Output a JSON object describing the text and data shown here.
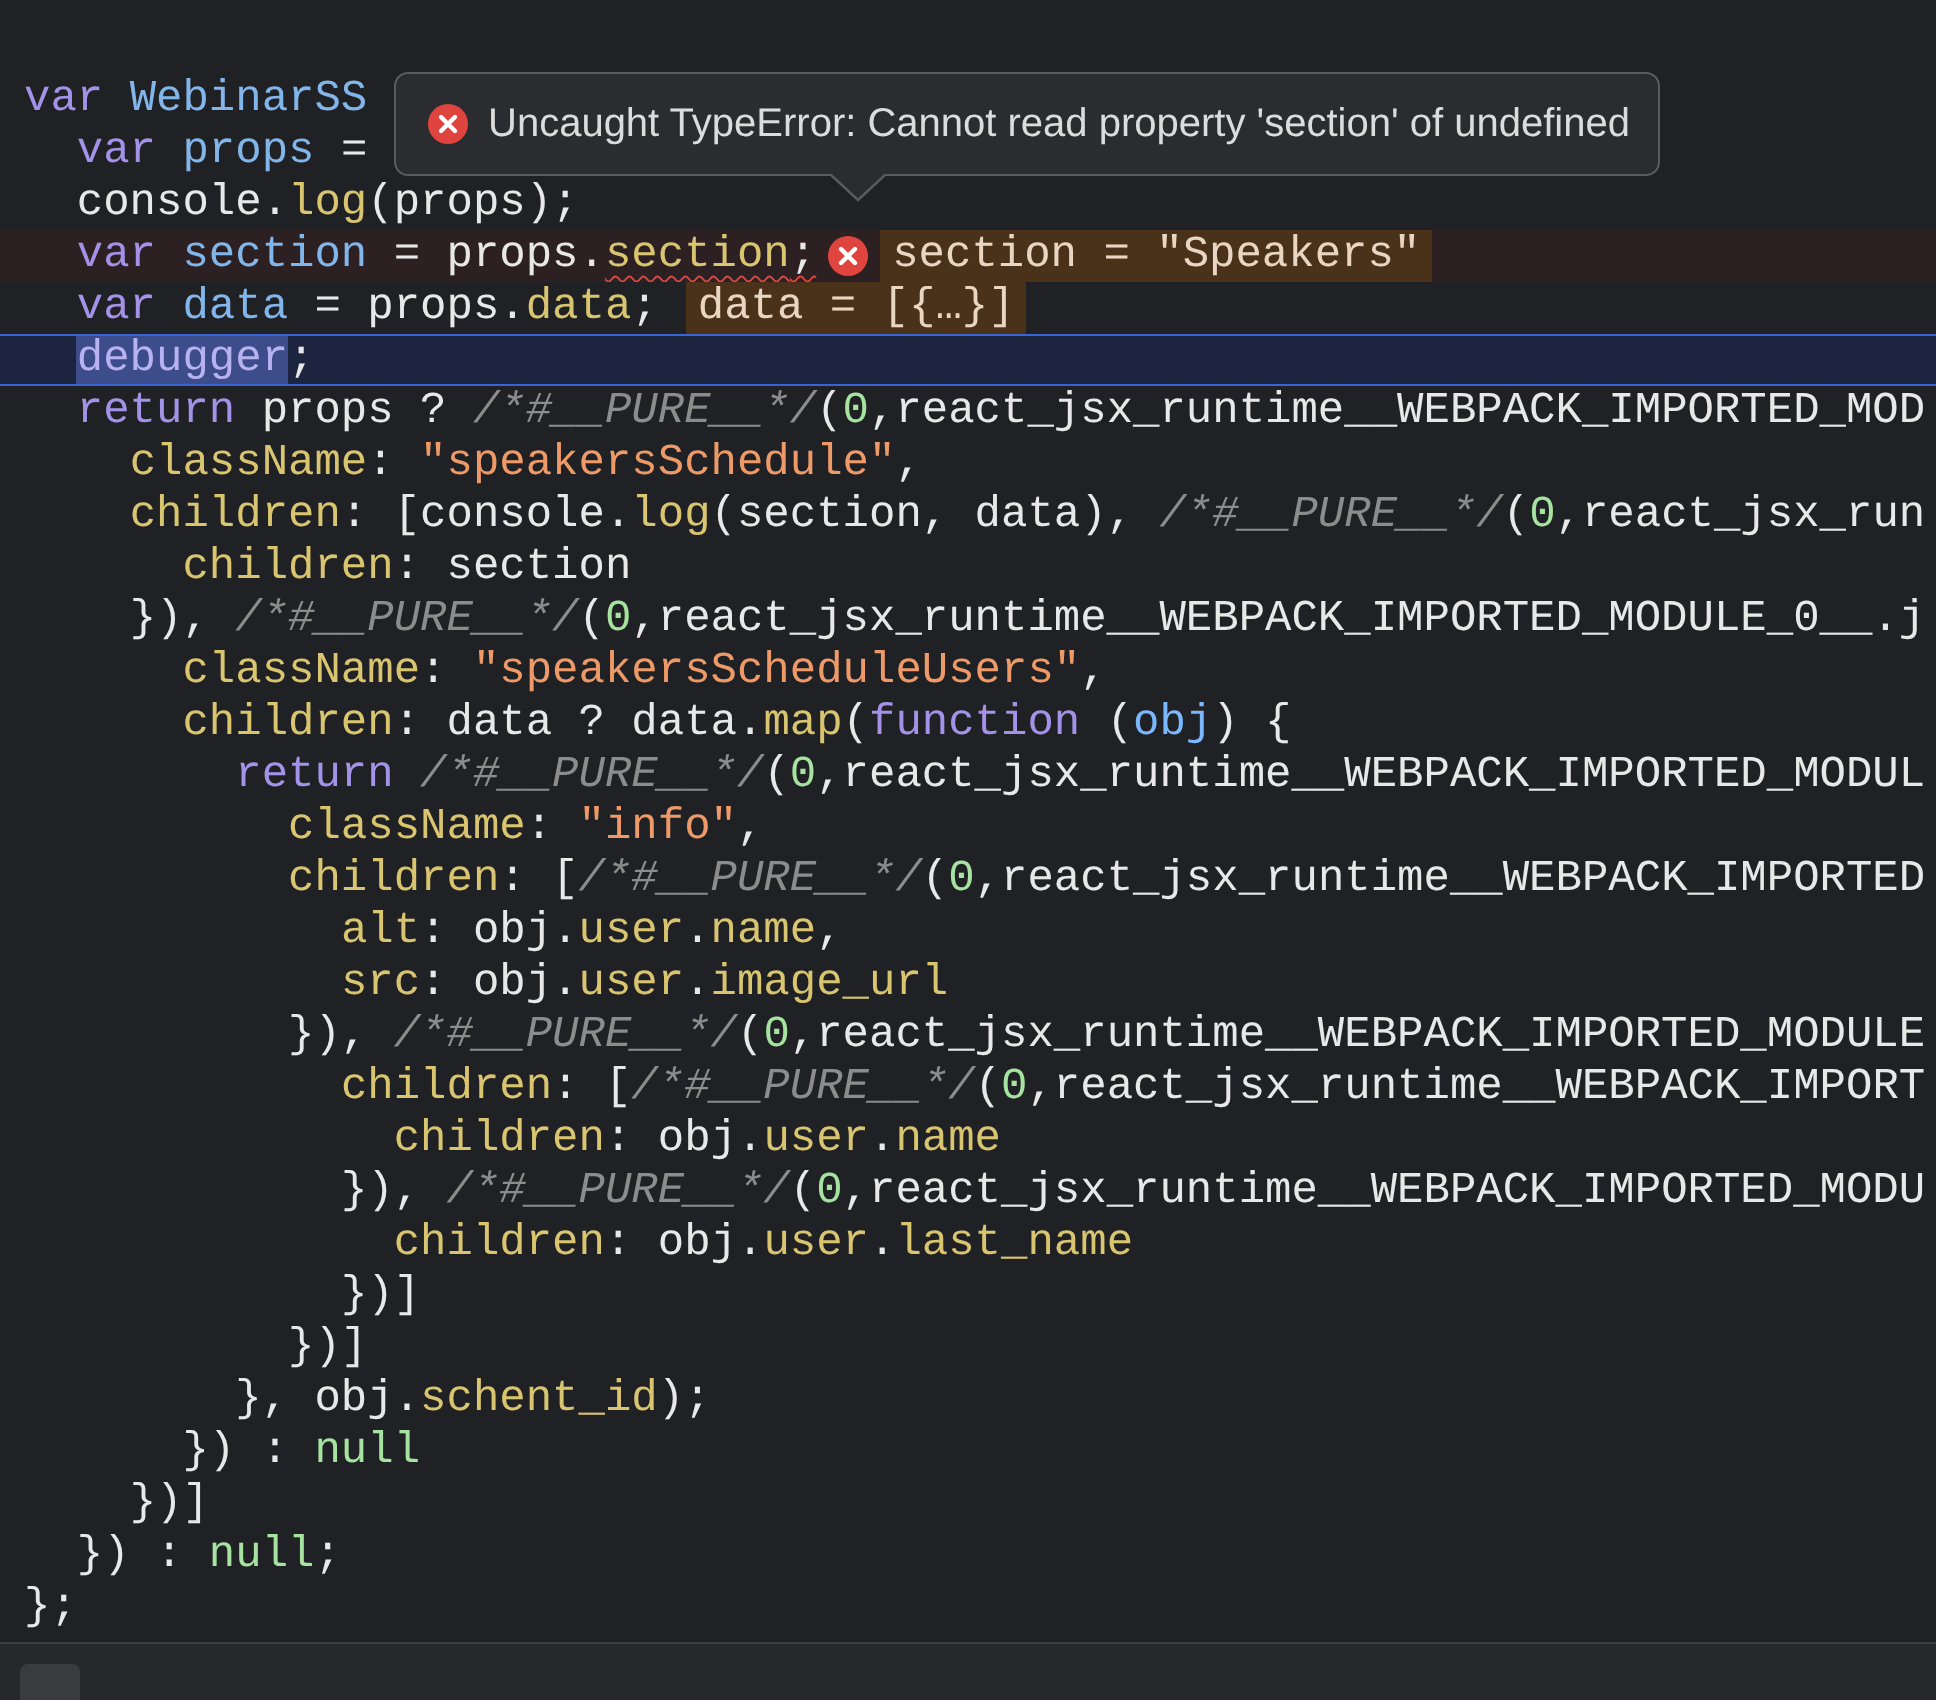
{
  "error_tooltip": {
    "message": "Uncaught TypeError: Cannot read property 'section' of undefined"
  },
  "editor": {
    "lines": [
      {
        "error": false,
        "paused": false,
        "tokens": [
          {
            "kind": "kw",
            "text": "var "
          },
          {
            "kind": "ident",
            "text": "WebinarSS"
          }
        ]
      },
      {
        "error": false,
        "paused": false,
        "tokens": [
          {
            "kind": "kw",
            "text": "  var "
          },
          {
            "kind": "ident",
            "text": "props"
          },
          {
            "kind": "plain",
            "text": " ="
          }
        ]
      },
      {
        "error": false,
        "paused": false,
        "tokens": [
          {
            "kind": "plain",
            "text": "  console."
          },
          {
            "kind": "prop",
            "text": "log"
          },
          {
            "kind": "plain",
            "text": "(props);"
          }
        ]
      },
      {
        "error": true,
        "paused": false,
        "inline_value": "section = \"Speakers\"",
        "tokens": [
          {
            "kind": "kw",
            "text": "  var "
          },
          {
            "kind": "ident",
            "text": "section"
          },
          {
            "kind": "plain",
            "text": " = props."
          },
          {
            "kind": "prop-squiggle",
            "text": "section"
          },
          {
            "kind": "plain-squiggle",
            "text": ";"
          }
        ]
      },
      {
        "error": false,
        "paused": false,
        "inline_value": "data = [{…}]",
        "tokens": [
          {
            "kind": "kw",
            "text": "  var "
          },
          {
            "kind": "ident",
            "text": "data"
          },
          {
            "kind": "plain",
            "text": " = props."
          },
          {
            "kind": "prop",
            "text": "data"
          },
          {
            "kind": "plain",
            "text": ";"
          }
        ]
      },
      {
        "error": false,
        "paused": true,
        "tokens": [
          {
            "kind": "selection",
            "text": "  debugger"
          },
          {
            "kind": "plain",
            "text": ";"
          }
        ]
      },
      {
        "error": false,
        "paused": false,
        "tokens": [
          {
            "kind": "kw",
            "text": "  return"
          },
          {
            "kind": "plain",
            "text": " props ? "
          },
          {
            "kind": "comment",
            "text": "/*#__PURE__*/"
          },
          {
            "kind": "plain",
            "text": "("
          },
          {
            "kind": "num",
            "text": "0"
          },
          {
            "kind": "plain",
            "text": ",react_jsx_runtime__WEBPACK_IMPORTED_MOD"
          }
        ]
      },
      {
        "error": false,
        "paused": false,
        "tokens": [
          {
            "kind": "prop",
            "text": "    className"
          },
          {
            "kind": "plain",
            "text": ": "
          },
          {
            "kind": "string",
            "text": "\"speakersSchedule\""
          },
          {
            "kind": "plain",
            "text": ","
          }
        ]
      },
      {
        "error": false,
        "paused": false,
        "tokens": [
          {
            "kind": "prop",
            "text": "    children"
          },
          {
            "kind": "plain",
            "text": ": [console."
          },
          {
            "kind": "prop",
            "text": "log"
          },
          {
            "kind": "plain",
            "text": "(section, data), "
          },
          {
            "kind": "comment",
            "text": "/*#__PURE__*/"
          },
          {
            "kind": "plain",
            "text": "("
          },
          {
            "kind": "num",
            "text": "0"
          },
          {
            "kind": "plain",
            "text": ",react_jsx_run"
          }
        ]
      },
      {
        "error": false,
        "paused": false,
        "tokens": [
          {
            "kind": "prop",
            "text": "      children"
          },
          {
            "kind": "plain",
            "text": ": section"
          }
        ]
      },
      {
        "error": false,
        "paused": false,
        "tokens": [
          {
            "kind": "plain",
            "text": "    }), "
          },
          {
            "kind": "comment",
            "text": "/*#__PURE__*/"
          },
          {
            "kind": "plain",
            "text": "("
          },
          {
            "kind": "num",
            "text": "0"
          },
          {
            "kind": "plain",
            "text": ",react_jsx_runtime__WEBPACK_IMPORTED_MODULE_0__.j"
          }
        ]
      },
      {
        "error": false,
        "paused": false,
        "tokens": [
          {
            "kind": "prop",
            "text": "      className"
          },
          {
            "kind": "plain",
            "text": ": "
          },
          {
            "kind": "string",
            "text": "\"speakersScheduleUsers\""
          },
          {
            "kind": "plain",
            "text": ","
          }
        ]
      },
      {
        "error": false,
        "paused": false,
        "tokens": [
          {
            "kind": "prop",
            "text": "      children"
          },
          {
            "kind": "plain",
            "text": ": data ? data."
          },
          {
            "kind": "prop",
            "text": "map"
          },
          {
            "kind": "plain",
            "text": "("
          },
          {
            "kind": "kw",
            "text": "function"
          },
          {
            "kind": "plain",
            "text": " ("
          },
          {
            "kind": "param",
            "text": "obj"
          },
          {
            "kind": "plain",
            "text": ") {"
          }
        ]
      },
      {
        "error": false,
        "paused": false,
        "tokens": [
          {
            "kind": "kw",
            "text": "        return "
          },
          {
            "kind": "comment",
            "text": "/*#__PURE__*/"
          },
          {
            "kind": "plain",
            "text": "("
          },
          {
            "kind": "num",
            "text": "0"
          },
          {
            "kind": "plain",
            "text": ",react_jsx_runtime__WEBPACK_IMPORTED_MODUL"
          }
        ]
      },
      {
        "error": false,
        "paused": false,
        "tokens": [
          {
            "kind": "prop",
            "text": "          className"
          },
          {
            "kind": "plain",
            "text": ": "
          },
          {
            "kind": "string",
            "text": "\"info\""
          },
          {
            "kind": "plain",
            "text": ","
          }
        ]
      },
      {
        "error": false,
        "paused": false,
        "tokens": [
          {
            "kind": "prop",
            "text": "          children"
          },
          {
            "kind": "plain",
            "text": ": ["
          },
          {
            "kind": "comment",
            "text": "/*#__PURE__*/"
          },
          {
            "kind": "plain",
            "text": "("
          },
          {
            "kind": "num",
            "text": "0"
          },
          {
            "kind": "plain",
            "text": ",react_jsx_runtime__WEBPACK_IMPORTED"
          }
        ]
      },
      {
        "error": false,
        "paused": false,
        "tokens": [
          {
            "kind": "prop",
            "text": "            alt"
          },
          {
            "kind": "plain",
            "text": ": obj."
          },
          {
            "kind": "prop",
            "text": "user"
          },
          {
            "kind": "plain",
            "text": "."
          },
          {
            "kind": "prop",
            "text": "name"
          },
          {
            "kind": "plain",
            "text": ","
          }
        ]
      },
      {
        "error": false,
        "paused": false,
        "tokens": [
          {
            "kind": "prop",
            "text": "            src"
          },
          {
            "kind": "plain",
            "text": ": obj."
          },
          {
            "kind": "prop",
            "text": "user"
          },
          {
            "kind": "plain",
            "text": "."
          },
          {
            "kind": "prop",
            "text": "image_url"
          }
        ]
      },
      {
        "error": false,
        "paused": false,
        "tokens": [
          {
            "kind": "plain",
            "text": "          }), "
          },
          {
            "kind": "comment",
            "text": "/*#__PURE__*/"
          },
          {
            "kind": "plain",
            "text": "("
          },
          {
            "kind": "num",
            "text": "0"
          },
          {
            "kind": "plain",
            "text": ",react_jsx_runtime__WEBPACK_IMPORTED_MODULE"
          }
        ]
      },
      {
        "error": false,
        "paused": false,
        "tokens": [
          {
            "kind": "prop",
            "text": "            children"
          },
          {
            "kind": "plain",
            "text": ": ["
          },
          {
            "kind": "comment",
            "text": "/*#__PURE__*/"
          },
          {
            "kind": "plain",
            "text": "("
          },
          {
            "kind": "num",
            "text": "0"
          },
          {
            "kind": "plain",
            "text": ",react_jsx_runtime__WEBPACK_IMPORT"
          }
        ]
      },
      {
        "error": false,
        "paused": false,
        "tokens": [
          {
            "kind": "prop",
            "text": "              children"
          },
          {
            "kind": "plain",
            "text": ": obj."
          },
          {
            "kind": "prop",
            "text": "user"
          },
          {
            "kind": "plain",
            "text": "."
          },
          {
            "kind": "prop",
            "text": "name"
          }
        ]
      },
      {
        "error": false,
        "paused": false,
        "tokens": [
          {
            "kind": "plain",
            "text": "            }), "
          },
          {
            "kind": "comment",
            "text": "/*#__PURE__*/"
          },
          {
            "kind": "plain",
            "text": "("
          },
          {
            "kind": "num",
            "text": "0"
          },
          {
            "kind": "plain",
            "text": ",react_jsx_runtime__WEBPACK_IMPORTED_MODU"
          }
        ]
      },
      {
        "error": false,
        "paused": false,
        "tokens": [
          {
            "kind": "prop",
            "text": "              children"
          },
          {
            "kind": "plain",
            "text": ": obj."
          },
          {
            "kind": "prop",
            "text": "user"
          },
          {
            "kind": "plain",
            "text": "."
          },
          {
            "kind": "prop",
            "text": "last_name"
          }
        ]
      },
      {
        "error": false,
        "paused": false,
        "tokens": [
          {
            "kind": "plain",
            "text": "            })]"
          }
        ]
      },
      {
        "error": false,
        "paused": false,
        "tokens": [
          {
            "kind": "plain",
            "text": "          })]"
          }
        ]
      },
      {
        "error": false,
        "paused": false,
        "tokens": [
          {
            "kind": "plain",
            "text": "        }, obj."
          },
          {
            "kind": "prop",
            "text": "schent_id"
          },
          {
            "kind": "plain",
            "text": ");"
          }
        ]
      },
      {
        "error": false,
        "paused": false,
        "tokens": [
          {
            "kind": "plain",
            "text": "      }) : "
          },
          {
            "kind": "num",
            "text": "null"
          }
        ]
      },
      {
        "error": false,
        "paused": false,
        "tokens": [
          {
            "kind": "plain",
            "text": "    })]"
          }
        ]
      },
      {
        "error": false,
        "paused": false,
        "tokens": [
          {
            "kind": "plain",
            "text": "  }) : "
          },
          {
            "kind": "num",
            "text": "null"
          },
          {
            "kind": "plain",
            "text": ";"
          }
        ]
      },
      {
        "error": false,
        "paused": false,
        "tokens": [
          {
            "kind": "plain",
            "text": "};"
          }
        ]
      }
    ]
  }
}
